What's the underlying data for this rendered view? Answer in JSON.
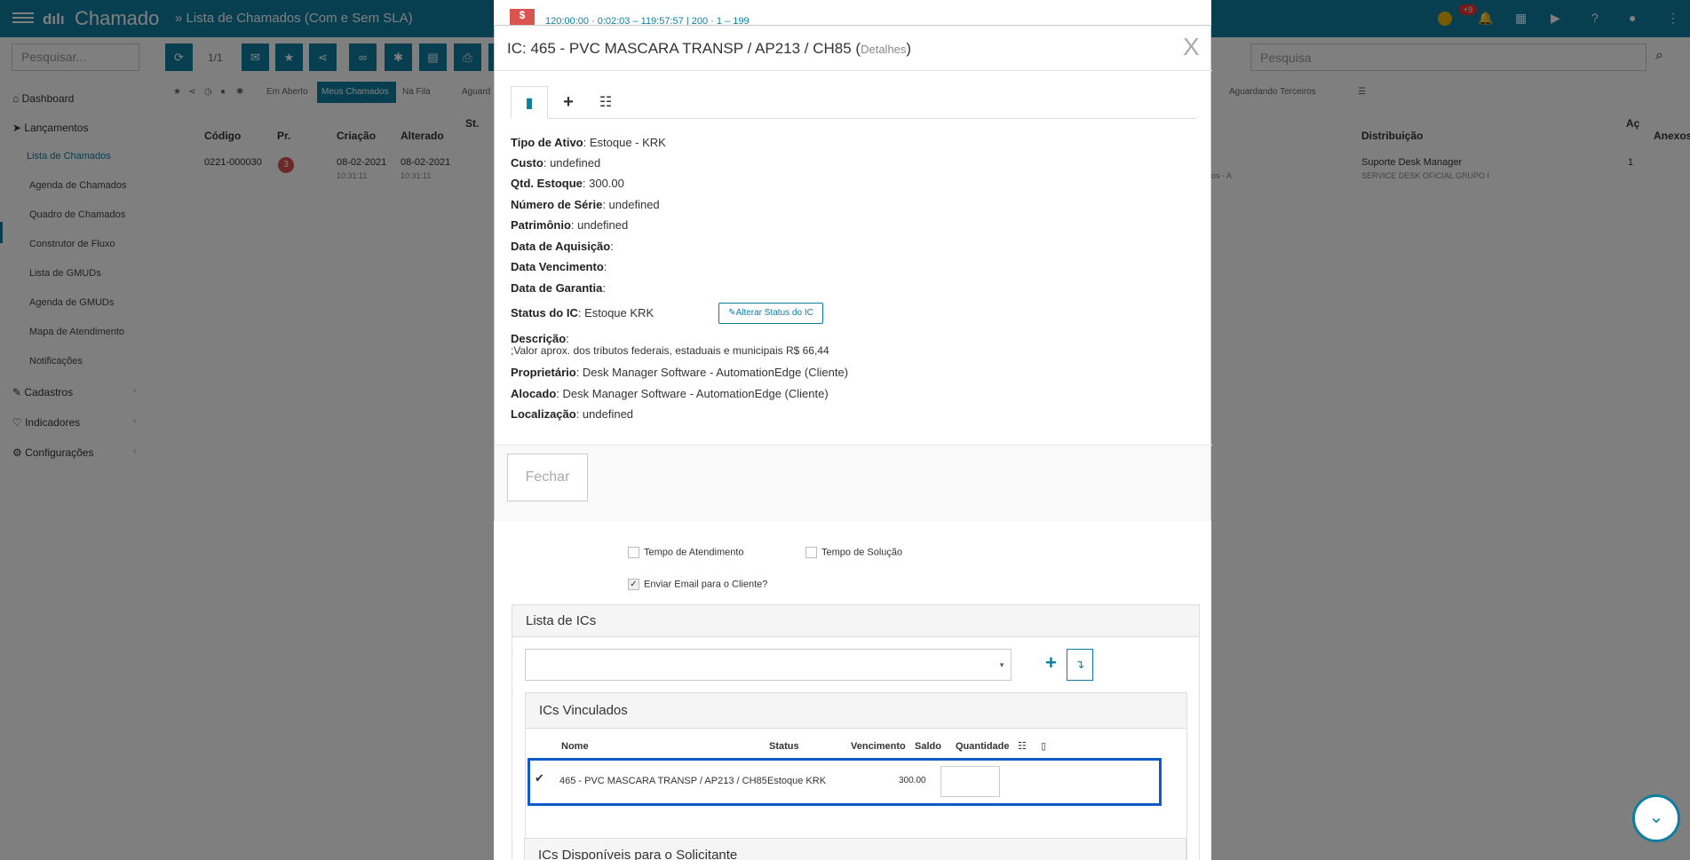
{
  "topbar": {
    "app": "Chamado",
    "breadcrumb": "» Lista de Chamados (Com e Sem SLA)",
    "badge": "+9"
  },
  "search": {
    "left_placeholder": "Pesquisar...",
    "right_placeholder": "Pesquisa",
    "page": "1/1"
  },
  "sidebar": {
    "dashboard": "Dashboard",
    "lancamentos": "Lançamentos",
    "sub": [
      "Lista de Chamados",
      "Agenda de Chamados",
      "Quadro de Chamados",
      "Construtor de Fluxo",
      "Lista de GMUDs",
      "Agenda de GMUDs",
      "Mapa de Atendimento",
      "Notificações"
    ],
    "cadastros": "Cadastros",
    "indicadores": "Indicadores",
    "configuracoes": "Configurações"
  },
  "filters": {
    "em_aberto": "Em Aberto",
    "meus": "Meus Chamados",
    "na_fila": "Na Fila",
    "aguardando": "Aguard",
    "terceiros": "Aguardando Terceiros"
  },
  "table": {
    "headers": {
      "codigo": "Código",
      "pr": "Pr.",
      "criacao": "Criação",
      "alterado": "Alterado",
      "st": "St.",
      "distribuicao": "Distribuição",
      "ac": "Aç",
      "anexos": "Anexos"
    },
    "row": {
      "codigo": "0221-000030",
      "prio": "3",
      "criacao": "08-02-2021",
      "criacao_time": "10:31:11",
      "alterado": "08-02-2021",
      "alterado_time": "10:31:11",
      "dist": "Suporte Desk Manager",
      "dist_sub": "SERVICE DESK OFICIAL GRUPO I",
      "count": "1",
      "frag": "ios - A"
    }
  },
  "strip": {
    "items": "120:00:00 · 0:02:03 – 119:57:57 | 200 · 1 – 199"
  },
  "modal": {
    "title": "IC: 465 - PVC MASCARA TRANSP / AP213 / CH85 (",
    "details": "Detalhes",
    "title_end": ")",
    "close_x": "X",
    "fields": [
      {
        "label": "Tipo de Ativo",
        "value": ": Estoque - KRK"
      },
      {
        "label": "Custo",
        "value": ": undefined"
      },
      {
        "label": "Qtd. Estoque",
        "value": ": 300.00"
      },
      {
        "label": "Número de Série",
        "value": ": undefined"
      },
      {
        "label": "Patrimônio",
        "value": ": undefined"
      },
      {
        "label": "Data de Aquisição",
        "value": ":"
      },
      {
        "label": "Data Vencimento",
        "value": ":"
      },
      {
        "label": "Data de Garantia",
        "value": ":"
      },
      {
        "label": "Status do IC",
        "value": ": Estoque KRK"
      }
    ],
    "status_button": "Alterar Status do IC",
    "descricao_label": "Descrição",
    "descricao_value": ";Valor aprox. dos tributos federais, estaduais e municipais R$ 66,44",
    "fields2": [
      {
        "label": "Proprietário",
        "value": ": Desk Manager Software - AutomationEdge (Cliente)"
      },
      {
        "label": "Alocado",
        "value": ": Desk Manager Software - AutomationEdge (Cliente)"
      },
      {
        "label": "Localização",
        "value": ": undefined"
      }
    ],
    "close_button": "Fechar"
  },
  "form": {
    "tempo_atendimento": "Tempo de Atendimento",
    "tempo_solucao": "Tempo de Solução",
    "enviar_email": "Enviar Email para o Cliente?",
    "lista_ics": "Lista de ICs",
    "ics_vinculados": "ICs Vinculados",
    "cols": {
      "nome": "Nome",
      "status": "Status",
      "vencimento": "Vencimento",
      "saldo": "Saldo",
      "quantidade": "Quantidade"
    },
    "row": {
      "nome": "465 - PVC MASCARA TRANSP / AP213 / CH85",
      "status": "Estoque KRK",
      "saldo": "300.00"
    },
    "ics_disponiveis": "ICs Disponíveis para o Solicitante"
  }
}
